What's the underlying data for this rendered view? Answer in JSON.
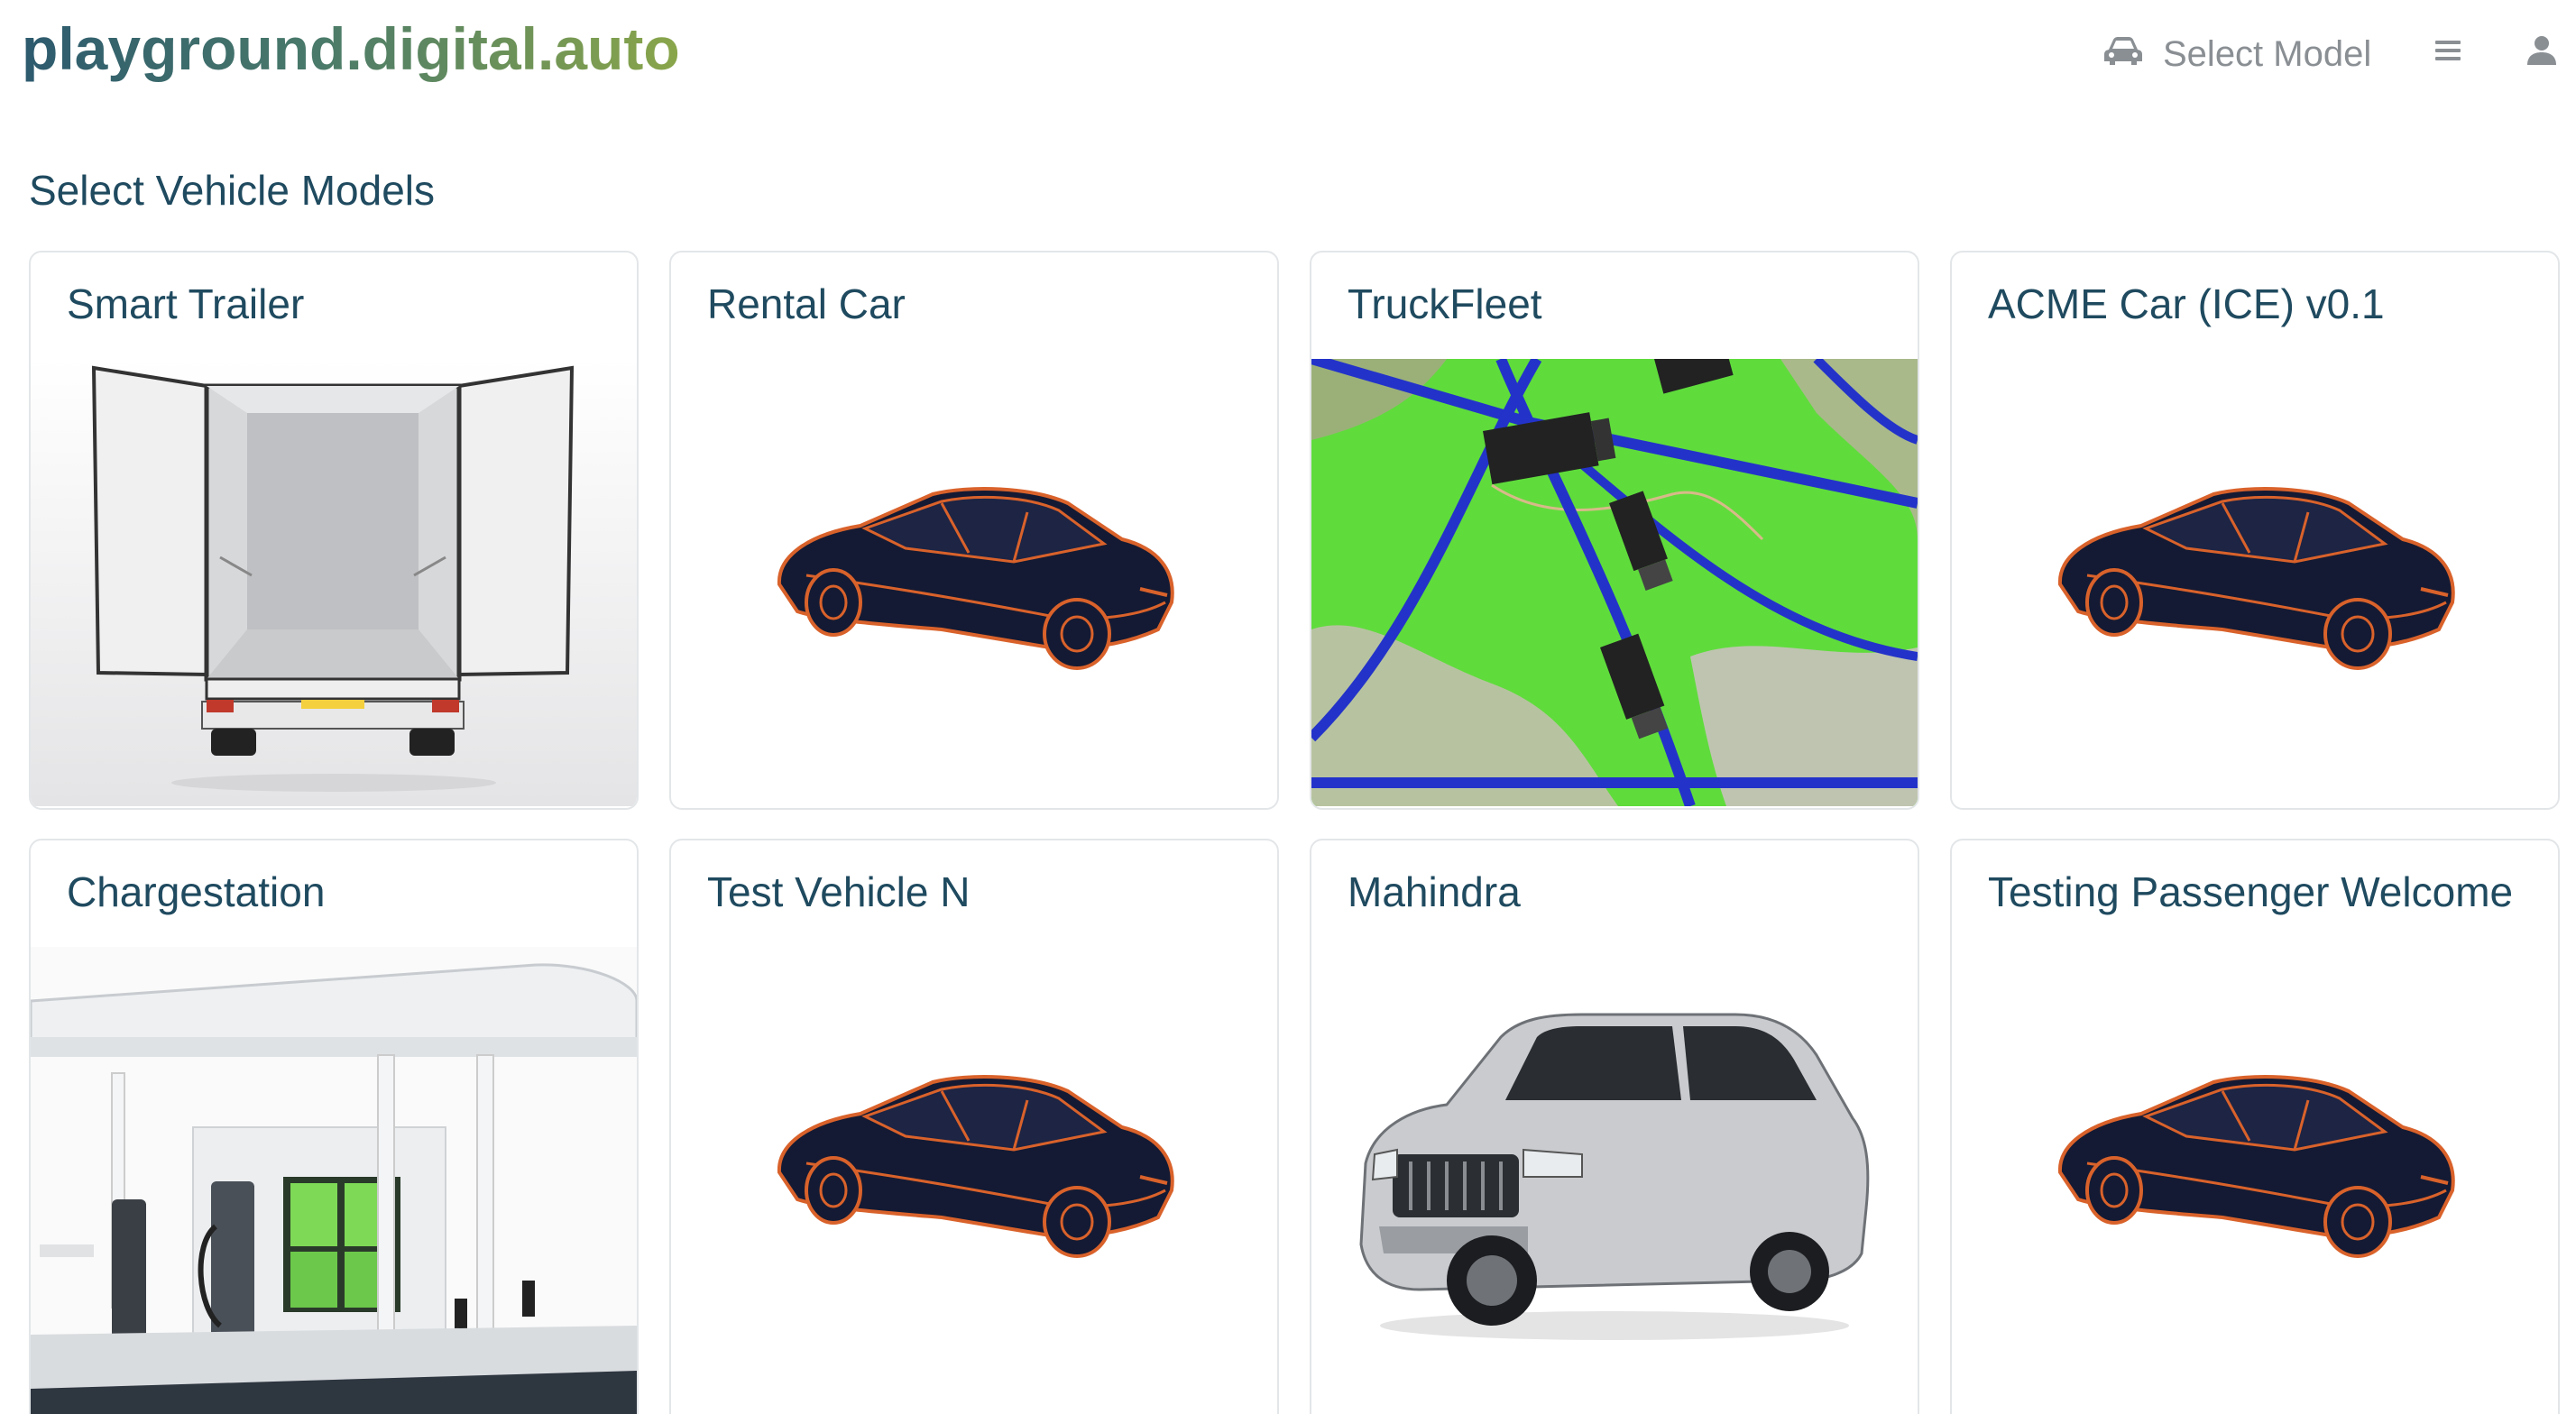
{
  "header": {
    "logo": "playground.digital.auto",
    "select_model_label": "Select Model",
    "icons": {
      "car": "car-icon",
      "menu": "hamburger-menu-icon",
      "user": "user-icon"
    }
  },
  "page": {
    "title": "Select Vehicle Models"
  },
  "models": [
    {
      "name": "Smart Trailer",
      "image": "trailer-image"
    },
    {
      "name": "Rental Car",
      "image": "sedan-wireframe-image"
    },
    {
      "name": "TruckFleet",
      "image": "truck-fleet-map-image"
    },
    {
      "name": "ACME Car (ICE) v0.1",
      "image": "sedan-wireframe-image"
    },
    {
      "name": "Chargestation",
      "image": "charging-station-image"
    },
    {
      "name": "Test Vehicle N",
      "image": "sedan-wireframe-image"
    },
    {
      "name": "Mahindra",
      "image": "suv-image"
    },
    {
      "name": "Testing Passenger Welcome",
      "image": "sedan-wireframe-image"
    }
  ],
  "colors": {
    "accent": "#1f4a5f",
    "wire": "#d9622b",
    "car_body": "#141a33",
    "map_green": "#5fdc3c",
    "road_blue": "#2333c9"
  }
}
